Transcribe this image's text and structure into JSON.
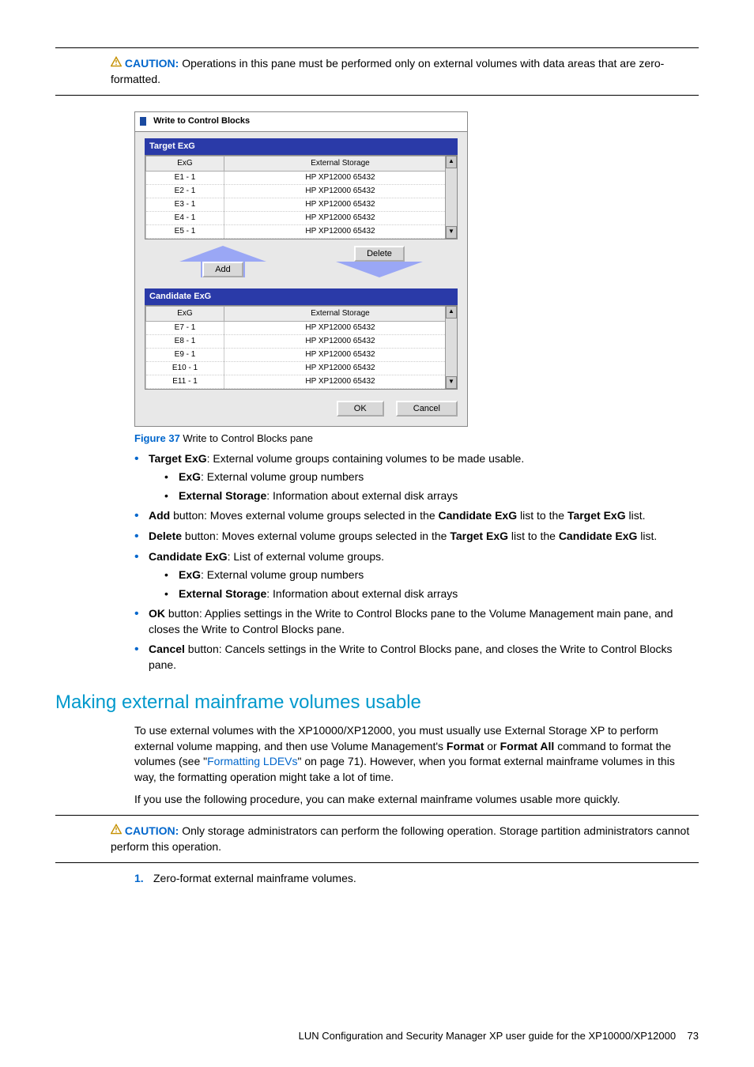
{
  "caution1": {
    "label": "CAUTION:",
    "text": "Operations in this pane must be performed only on external volumes with data areas that are zero-formatted."
  },
  "figure": {
    "label": "Figure 37",
    "caption": "Write to Control Blocks pane",
    "window_title": "Write to Control Blocks",
    "target_header": "Target ExG",
    "candidate_header": "Candidate ExG",
    "col_exg": "ExG",
    "col_storage": "External Storage",
    "add_btn": "Add",
    "delete_btn": "Delete",
    "ok_btn": "OK",
    "cancel_btn": "Cancel",
    "target_rows": [
      {
        "exg": "E1 - 1",
        "storage": "HP XP12000 65432"
      },
      {
        "exg": "E2 - 1",
        "storage": "HP XP12000 65432"
      },
      {
        "exg": "E3 - 1",
        "storage": "HP XP12000 65432"
      },
      {
        "exg": "E4 - 1",
        "storage": "HP XP12000 65432"
      },
      {
        "exg": "E5 - 1",
        "storage": "HP XP12000 65432"
      }
    ],
    "candidate_rows": [
      {
        "exg": "E7 - 1",
        "storage": "HP XP12000 65432"
      },
      {
        "exg": "E8 - 1",
        "storage": "HP XP12000 65432"
      },
      {
        "exg": "E9 - 1",
        "storage": "HP XP12000 65432"
      },
      {
        "exg": "E10 - 1",
        "storage": "HP XP12000 65432"
      },
      {
        "exg": "E11 - 1",
        "storage": "HP XP12000 65432"
      }
    ]
  },
  "bullets": {
    "target_exg_b": "Target ExG",
    "target_exg_t": ": External volume groups containing volumes to be made usable.",
    "exg_b": "ExG",
    "exg_t": ": External volume group numbers",
    "extstor_b": "External Storage",
    "extstor_t": ": Information about external disk arrays",
    "add_b": "Add",
    "add_t1": " button: Moves external volume groups selected in the ",
    "add_t2": "Candidate ExG",
    "add_t3": " list to the ",
    "add_t4": "Target ExG",
    "add_t5": " list.",
    "delete_b": "Delete",
    "delete_t1": " button: Moves external volume groups selected in the ",
    "delete_t2": "Target ExG",
    "delete_t3": " list to the ",
    "delete_t4": "Candidate ExG",
    "delete_t5": " list.",
    "cand_b": "Candidate ExG",
    "cand_t": ": List of external volume groups.",
    "ok_b": "OK",
    "ok_t": " button: Applies settings in the Write to Control Blocks pane to the Volume Management main pane, and closes the Write to Control Blocks pane.",
    "cancel_b": "Cancel",
    "cancel_t": " button: Cancels settings in the Write to Control Blocks pane, and closes the Write to Control Blocks pane."
  },
  "section": {
    "heading": "Making external mainframe volumes usable",
    "p1a": "To use external volumes with the XP10000/XP12000, you must usually use External Storage XP to perform external volume mapping, and then use Volume Management's ",
    "p1b": "Format",
    "p1c": " or ",
    "p1d": "Format All",
    "p1e": " command to format the volumes (see \"",
    "p1link": "Formatting LDEVs",
    "p1f": "\" on page 71). However, when you format external mainframe volumes in this way, the formatting operation might take a lot of time.",
    "p2": "If you use the following procedure, you can make external mainframe volumes usable more quickly."
  },
  "caution2": {
    "label": "CAUTION:",
    "text": "Only storage administrators can perform the following operation. Storage partition administrators cannot perform this operation."
  },
  "steps": {
    "n1": "1.",
    "s1": "Zero-format external mainframe volumes."
  },
  "footer": {
    "text": "LUN Configuration and Security Manager XP user guide for the XP10000/XP12000",
    "page": "73"
  }
}
